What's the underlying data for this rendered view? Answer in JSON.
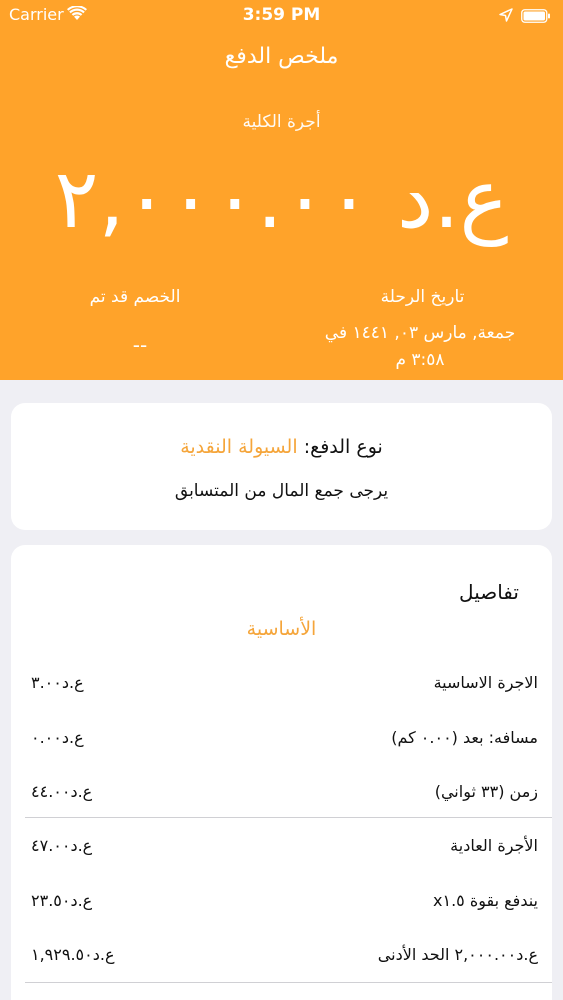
{
  "status_bar": {
    "carrier": "Carrier",
    "time": "3:59 PM"
  },
  "header": {
    "title": "ملخص الدفع",
    "fare_label": "أجرة الكلية",
    "fare_amount": "ع.د ٢,٠٠٠.٠٠",
    "discount_label": "الخصم قد تم",
    "discount_value": "--",
    "trip_date_label": "تاريخ الرحلة",
    "trip_date_line1": "جمعة, مارس ٠٣, ١٤٤١ في",
    "trip_date_line2": "٣:٥٨ م"
  },
  "payment": {
    "type_label": "نوع الدفع:",
    "method": "السيولة النقدية",
    "note": "يرجى جمع المال من المتسابق"
  },
  "details": {
    "title": "تفاصيل",
    "section": "الأساسية",
    "rows": [
      {
        "label": "الاجرة الاساسية",
        "value": "ع.د٣.٠٠"
      },
      {
        "label": "مسافه: بعد (٠.٠٠ كم)",
        "value": "ع.د٠.٠٠"
      },
      {
        "label": "زمن (٣٣ ثواني)",
        "value": "ع.د٤٤.٠٠"
      },
      {
        "label": "الأجرة العادية",
        "value": "ع.د٤٧.٠٠"
      },
      {
        "label": "يندفع بقوة x١.٥",
        "value": "ع.د٢٣.٥٠"
      },
      {
        "label": "ع.د٢,٠٠٠.٠٠ الحد الأدنى",
        "value": "ع.د١,٩٢٩.٥٠"
      }
    ]
  },
  "colors": {
    "accent": "#ffa32a",
    "accent_text": "#f5a53a",
    "background": "#efeff4"
  }
}
